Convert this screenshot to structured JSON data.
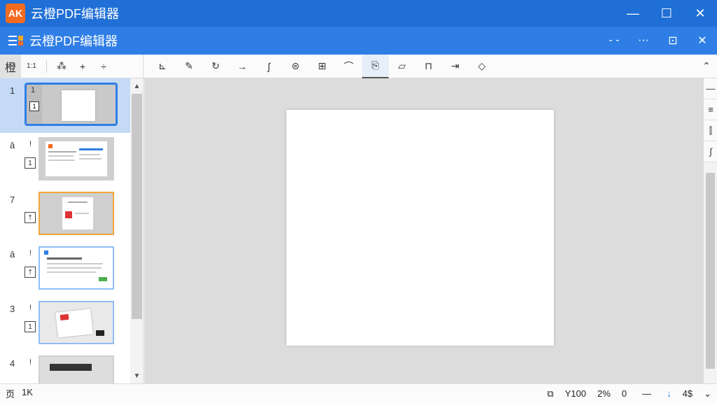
{
  "window": {
    "logo_text": "AK",
    "title": "云橙PDF编辑器",
    "minimize": "—",
    "maximize": "☐",
    "close": "✕"
  },
  "appbar": {
    "title": "云橙PDF编辑器",
    "btn_dash": "- -",
    "btn_more": "···",
    "btn_export": "⊡",
    "btn_close": "✕"
  },
  "toolbar": {
    "tab_label": "橙",
    "small_label": "1:1",
    "btn_scan": "⁂",
    "btn_add": "+",
    "btn_divide": "÷",
    "tools": [
      "⊾",
      "✎",
      "↻",
      "→",
      "∫",
      "⊜",
      "⊞",
      "⌒",
      "⎘",
      "▱",
      "⊓",
      "⇥",
      "◇"
    ],
    "active_tool_index": 8,
    "collapse": "⌃"
  },
  "sidebar": {
    "thumbs": [
      {
        "num": "1",
        "mark": "1",
        "box": "1"
      },
      {
        "num": "ā",
        "mark": "!",
        "box": "1"
      },
      {
        "num": "7",
        "mark": "!",
        "box": "†"
      },
      {
        "num": "ā",
        "mark": "!",
        "box": "†"
      },
      {
        "num": "3",
        "mark": "!",
        "box": "1"
      },
      {
        "num": "4",
        "mark": "!",
        "box": ""
      }
    ],
    "scroll_up": "▲",
    "scroll_down": "▼"
  },
  "right_panel": {
    "btn1": "—",
    "btn2": "≡",
    "btn3": "⫿",
    "btn4": "∫"
  },
  "statusbar": {
    "left1": "页",
    "left2": "1K",
    "page_icon": "⧉",
    "page_count": "Y100",
    "zoom": "2%",
    "rotate": "0",
    "zoom_out": "—",
    "download": "↓",
    "page_total": "4$",
    "chev": "⌄"
  },
  "colors": {
    "title_bar": "#1f6fd6",
    "app_bar": "#2f7ee6",
    "accent_orange": "#f26b21",
    "selection": "#c5dbf5"
  }
}
